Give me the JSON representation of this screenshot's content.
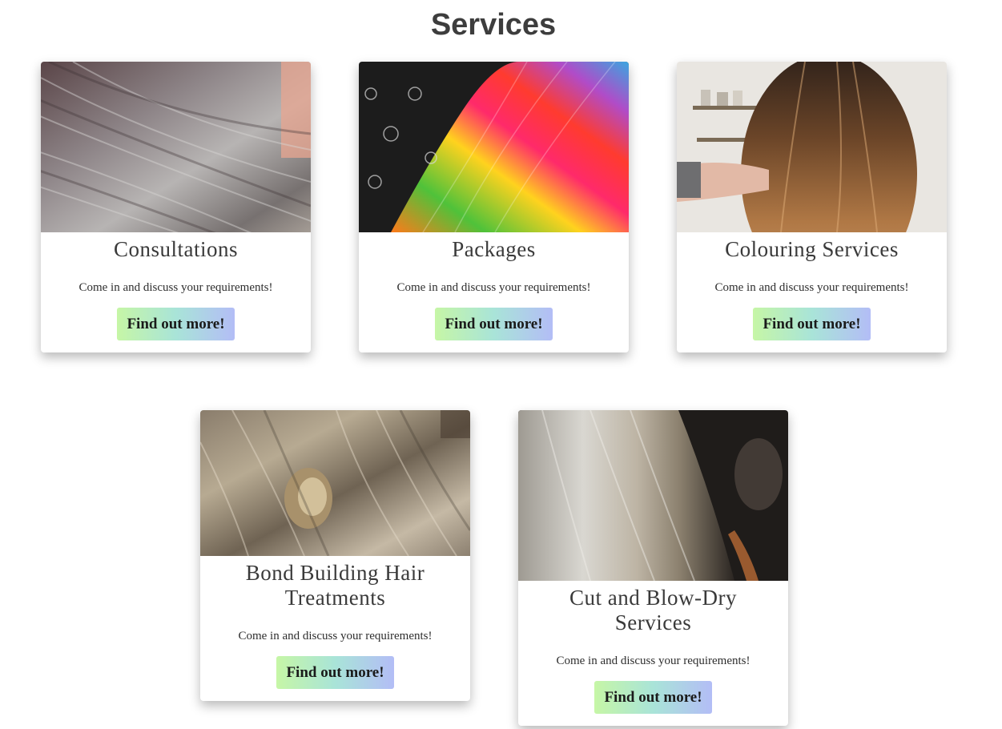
{
  "page": {
    "title": "Services"
  },
  "colors": {
    "button_gradient_start": "#c6f6a6",
    "button_gradient_mid": "#a9e4d8",
    "button_gradient_end": "#b3bdf6",
    "title_text": "#3d3d3d"
  },
  "services": [
    {
      "title": "Consultations",
      "description": "Come in and discuss your requirements!",
      "button_label": "Find out more!",
      "image_alt": "silver-grey-hair-photo"
    },
    {
      "title": "Packages",
      "description": "Come in and discuss your requirements!",
      "button_label": "Find out more!",
      "image_alt": "rainbow-hair-photo"
    },
    {
      "title": "Colouring Services",
      "description": "Come in and discuss your requirements!",
      "button_label": "Find out more!",
      "image_alt": "balayage-brown-hair-photo"
    },
    {
      "title": "Bond Building Hair Treatments",
      "description": "Come in and discuss your requirements!",
      "button_label": "Find out more!",
      "image_alt": "knotted-blonde-hair-photo"
    },
    {
      "title": "Cut and Blow-Dry Services",
      "description": "Come in and discuss your requirements!",
      "button_label": "Find out more!",
      "image_alt": "sleek-blonde-hair-photo"
    }
  ]
}
